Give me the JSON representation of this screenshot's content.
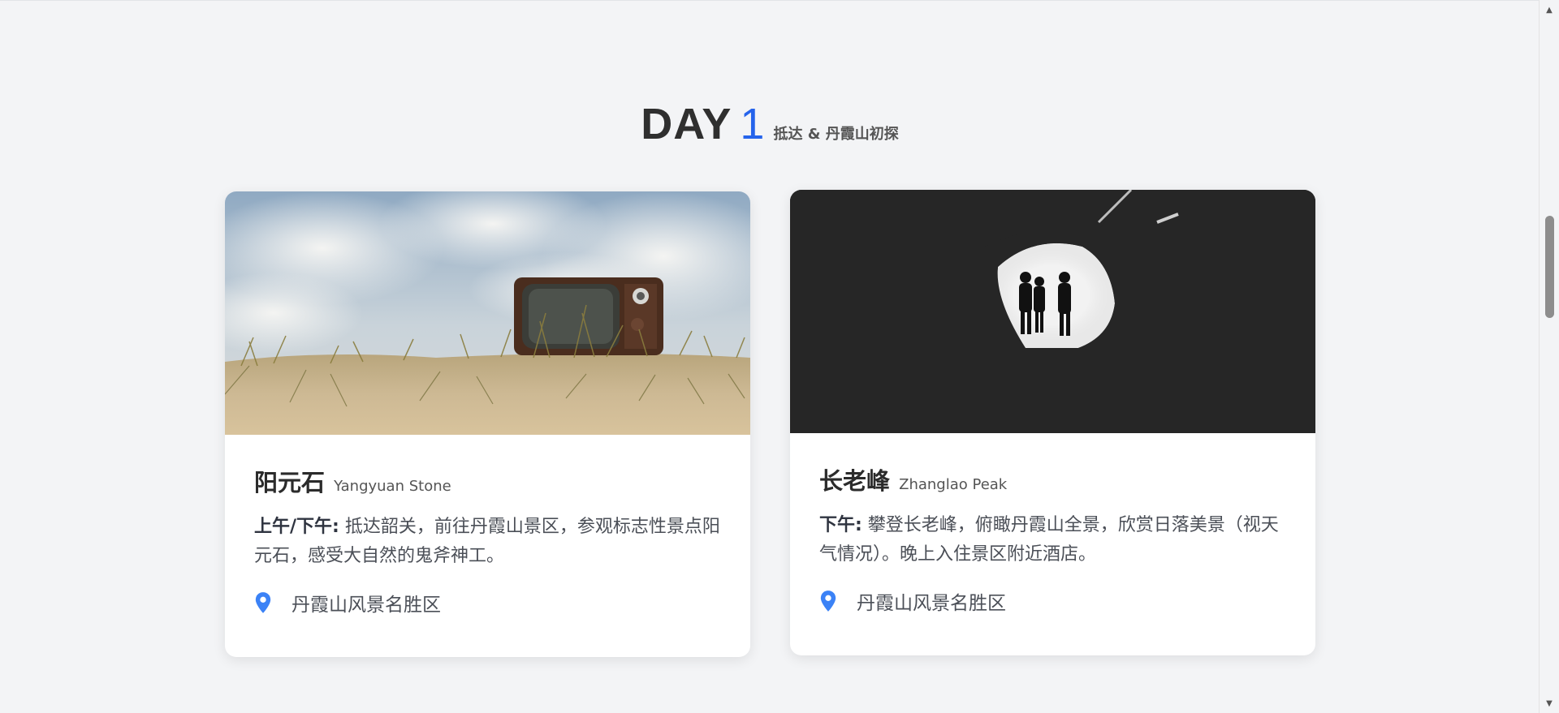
{
  "day": {
    "label": "DAY",
    "number": "1",
    "subtitle": "抵达 & 丹霞山初探"
  },
  "cards": [
    {
      "title": "阳元石",
      "title_en": "Yangyuan Stone",
      "time_label": "上午/下午:",
      "description": " 抵达韶关，前往丹霞山景区，参观标志性景点阳元石，感受大自然的鬼斧神工。",
      "location": "丹霞山风景名胜区",
      "image_icon": "retro-tv-on-dune-photo"
    },
    {
      "title": "长老峰",
      "title_en": "Zhanglao Peak",
      "time_label": "下午:",
      "description": " 攀登长老峰，俯瞰丹霞山全景，欣赏日落美景（视天气情况）。晚上入住景区附近酒店。",
      "location": "丹霞山风景名胜区",
      "image_icon": "cave-silhouettes-photo"
    }
  ],
  "icons": {
    "location": "map-pin-icon",
    "scroll_up": "scroll-up-arrow",
    "scroll_down": "scroll-down-arrow"
  },
  "colors": {
    "accent": "#2563eb",
    "pin": "#3b82f6",
    "background": "#f3f4f6"
  }
}
